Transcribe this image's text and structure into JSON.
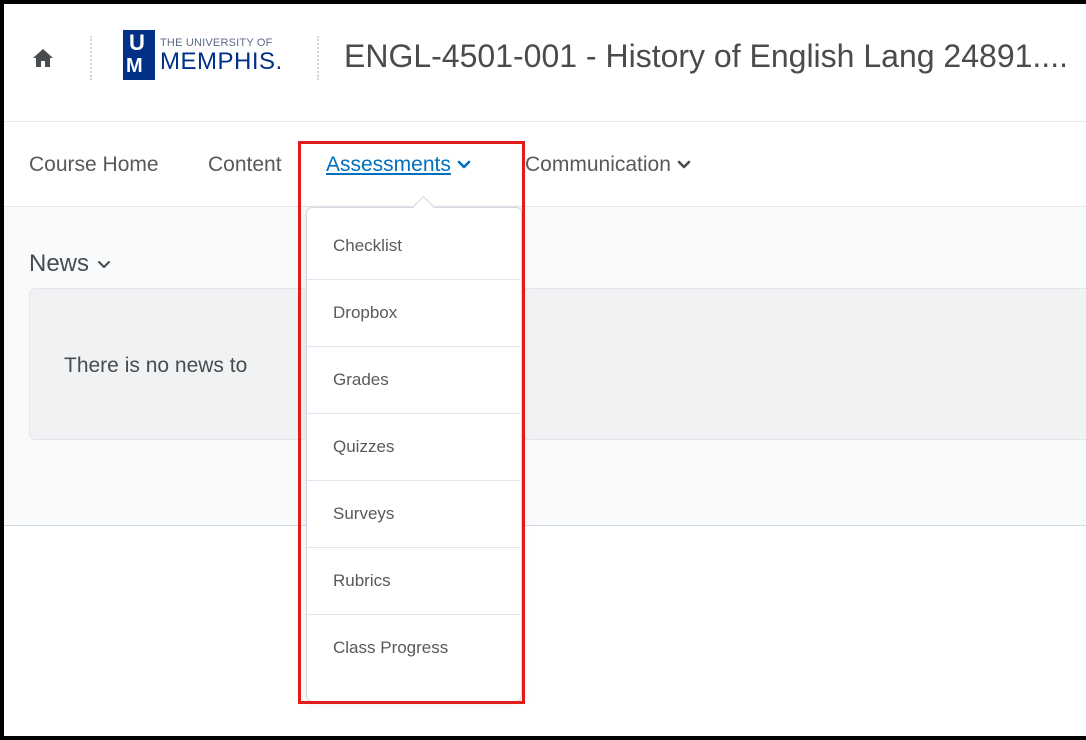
{
  "header": {
    "logo_small": "THE UNIVERSITY OF",
    "logo_big": "MEMPHIS.",
    "logo_u": "U",
    "logo_m": "M",
    "course_title": "ENGL-4501-001 - History of English Lang 24891...."
  },
  "nav": {
    "items": [
      {
        "label": "Course Home"
      },
      {
        "label": "Content"
      },
      {
        "label": "Assessments"
      },
      {
        "label": "Communication"
      }
    ]
  },
  "news": {
    "title": "News",
    "empty_message": "There is no news to"
  },
  "dropdown": {
    "items": [
      {
        "label": "Checklist"
      },
      {
        "label": "Dropbox"
      },
      {
        "label": "Grades"
      },
      {
        "label": "Quizzes"
      },
      {
        "label": "Surveys"
      },
      {
        "label": "Rubrics"
      },
      {
        "label": "Class Progress"
      }
    ]
  },
  "colors": {
    "accent_link": "#006fbf",
    "brand_blue": "#003087",
    "highlight_red": "#e21b1b"
  },
  "icons": {
    "home": "home-icon",
    "chevron": "chevron-down-icon"
  }
}
